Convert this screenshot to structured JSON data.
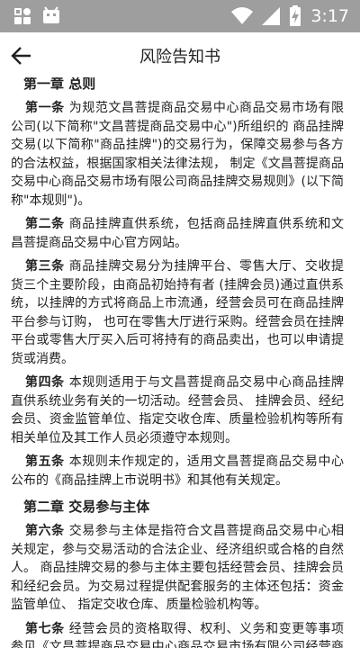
{
  "status_bar": {
    "time": "3:17",
    "icons": [
      "gallery-icon",
      "android-icon",
      "wifi-icon",
      "signal-icon",
      "battery-charging-icon"
    ]
  },
  "app_bar": {
    "title": "风险告知书",
    "back_icon": "arrow-left-icon"
  },
  "document": {
    "chapter1": "第一章  总则",
    "a1_head": "第一条",
    "a1_text": " 为规范文昌菩提商品交易中心商品交易市场有限公司(以下简称\"文昌菩提商品交易中心\")所组织的 商品挂牌交易(以下简称\"商品挂牌\")的交易行为，保障交易参与各方的合法权益，根据国家相关法律法规， 制定《文昌菩提商品交易中心商品交易市场有限公司商品挂牌交易规则》(以下简称\"本规则\")。",
    "a2_head": "第二条",
    "a2_text": " 商品挂牌直供系统，包括商品挂牌直供系统和文昌菩提商品交易中心官方网站。",
    "a3_head": "第三条",
    "a3_text": " 商品挂牌交易分为挂牌平台、零售大厅、交收提货三个主要阶段，由商品初始持有者 (挂牌会员)通过直供系统，以挂牌的方式将商品上市流通，经营会员可在商品挂牌平台参与订购， 也可在零售大厅进行采购。经营会员在挂牌平台或零售大厅买入后可将持有的商品卖出，也可以申请提货或消费。",
    "a4_head": "第四条",
    "a4_text": " 本规则适用于与文昌菩提商品交易中心商品挂牌直供系统业务有关的一切活动。经营会员、 挂牌会员、经纪会员、资金监管单位、指定交收仓库、质量检验机构等所有相关单位及其工作人员必须遵守本规则。",
    "a5_head": "第五条",
    "a5_text": " 本规则未作规定的，适用文昌菩提商品交易中心公布的《商品挂牌上市说明书》和其他有关规定。",
    "chapter2": "第二章  交易参与主体",
    "a6_head": "第六条",
    "a6_text": " 交易参与主体是指符合文昌菩提商品交易中心相关规定，参与交易活动的合法企业、经济组织或合格的自然人。 商品挂牌交易的参与主体主要包括经营会员、挂牌会员和经纪会员。为交易过程提供配套服务的主体还包括：资金监管单位、 指定交收仓库、质量检验机构等。",
    "a7_head": "第七条",
    "a7_text": " 经营会员的资格取得、权利、义务和变更等事项参见《文昌菩提商品交易中心商品交易市场有限公司经营商管理办法》。"
  }
}
